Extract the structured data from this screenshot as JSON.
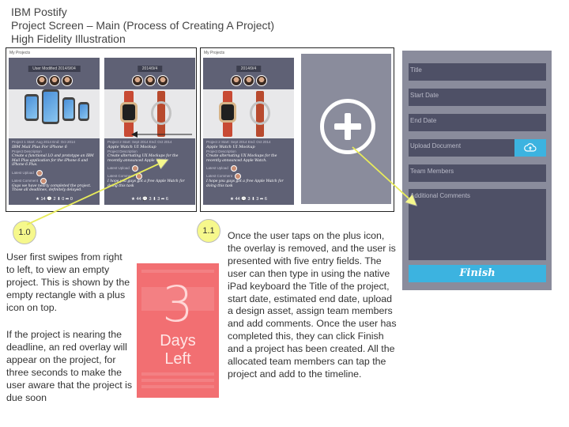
{
  "header": {
    "line1": "IBM Postify",
    "line2": "Project Screen – Main (Process of Creating A Project)",
    "line3": "High Fidelity Illustration"
  },
  "screen_left": {
    "label": "My Projects",
    "card1": {
      "pill": "User Modified 2014/9/04",
      "meta_line": "Project 1   Start: Aug 2014  End: Oct 2014",
      "title": "IBM Mail Plus For iPhone 6",
      "desc_label": "Project Description",
      "desc": "Create a functional LO and prototype an IBM Mail Plus application for the iPhone 6 and iPhone 6 Plus.",
      "upload_label": "Latest Upload",
      "comment_label": "Latest Comment",
      "comment": "Guys we have nearly completed the project. Those all deadlines, definitely delayed.",
      "stats": "★ 14  💬 2  ⬇ 0  ➦ 0"
    },
    "card2": {
      "pill": "2014/9/4",
      "meta_line": "Project 2   Start: Sept 2014  End: Oct 2014",
      "title": "Apple Watch UI Mockup",
      "desc_label": "Project Description",
      "desc": "Create alternating UX Mockups for the recently announced Apple Watch.",
      "upload_label": "Latest Upload",
      "comment_label": "Latest Comment",
      "comment": "I hope you guys got a free Apple Watch for doing this task",
      "stats": "★ 44  💬 3  ⬇ 3  ➦ 6"
    }
  },
  "screen_right": {
    "label": "My Projects",
    "card": {
      "pill": "2014/9/4",
      "meta_line": "Project 2   Start: Sept 2014  End: Oct 2014",
      "title": "Apple Watch UI Mockup",
      "desc_label": "Project Description",
      "desc": "Create alternating UX Mockups for the recently announced Apple Watch.",
      "upload_label": "Latest Upload",
      "comment_label": "Latest Comment",
      "comment": "I hope you guys got a free Apple Watch for doing this task",
      "stats": "★ 44  💬 3  ⬇ 3  ➦ 6"
    }
  },
  "form": {
    "title_placeholder": "Title",
    "start_date_placeholder": "Start Date",
    "end_date_placeholder": "End Date",
    "upload_placeholder": "Upload Document",
    "team_placeholder": "Team Members",
    "comments_placeholder": "Additional Comments",
    "finish_label": "Finish"
  },
  "annotations": {
    "step1_label": "1.0",
    "step2_label": "1.1",
    "note_left_1": "User first swipes from right to left, to view an empty project. This is shown by the empty rectangle with a plus icon on top.",
    "note_left_2": "If the project is nearing the deadline, an red overlay will appear on the project, for three seconds to make the user aware that the project is due soon",
    "note_right": "Once the user taps on the plus icon, the overlay is removed, and the user is presented with five entry fields. The user can then type in using the native iPad keyboard the Title of the project, start date, estimated end date, upload a design asset, assign team members and add comments. Once the user has completed this, they can click Finish and a project has been created. All the allocated team members can tap the project and add to the timeline."
  },
  "overlay": {
    "number": "3",
    "word1": "Days",
    "word2": "Left"
  },
  "colors": {
    "card_bg": "#5f6175",
    "panel_bg": "#8a8c9c",
    "field_bg": "#4e5066",
    "accent": "#3cb3e0",
    "overlay": "#f0575a",
    "marker": "#f6f88c"
  }
}
